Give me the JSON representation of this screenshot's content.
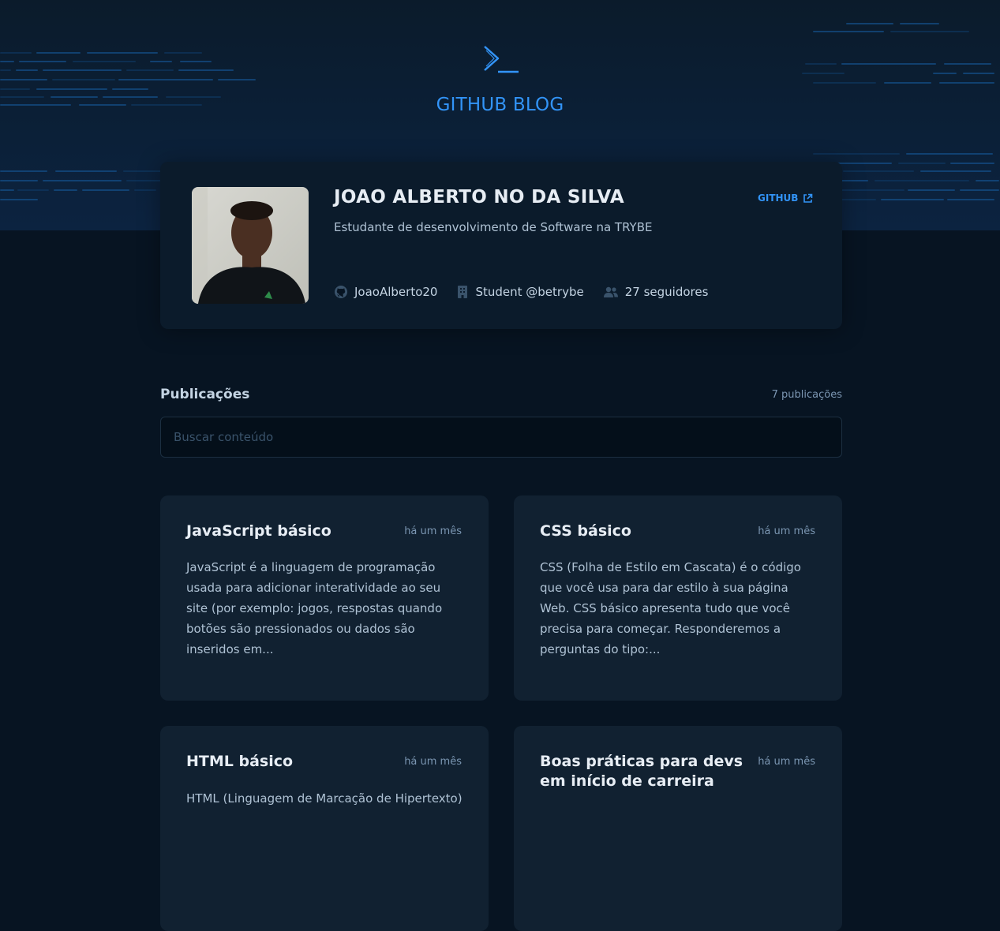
{
  "header": {
    "logo_icon": "terminal-icon",
    "title": "GITHUB BLOG",
    "accent_color": "#3294f8"
  },
  "profile": {
    "name": "JOAO ALBERTO NO DA SILVA",
    "link_label": "GITHUB",
    "link_icon": "external-link-icon",
    "bio": "Estudante de desenvolvimento de Software na TRYBE",
    "username": "JoaoAlberto20",
    "company": "Student @betrybe",
    "followers": "27 seguidores"
  },
  "publications": {
    "title": "Publicações",
    "count": "7 publicações",
    "search_placeholder": "Buscar conteúdo",
    "posts": [
      {
        "title": "JavaScript básico",
        "date": "há um mês",
        "excerpt": "JavaScript é a linguagem de programação usada para adicionar interatividade ao seu site (por exemplo: jogos, respostas quando botões são pressionados ou dados são inseridos em..."
      },
      {
        "title": "CSS básico",
        "date": "há um mês",
        "excerpt": "CSS (Folha de Estilo em Cascata) é o código que você usa para dar estilo à sua página Web. CSS básico apresenta tudo que você precisa para começar. Responderemos a perguntas do tipo:..."
      },
      {
        "title": "HTML básico",
        "date": "há um mês",
        "excerpt": "HTML (Linguagem de Marcação de Hipertexto)"
      },
      {
        "title": "Boas práticas para devs em início de carreira",
        "date": "há um mês",
        "excerpt": ""
      }
    ]
  }
}
